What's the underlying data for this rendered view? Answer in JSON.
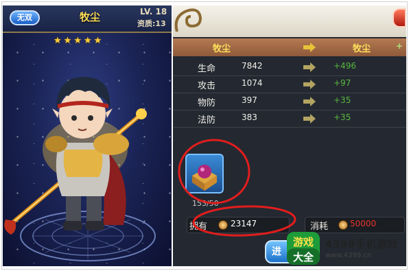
{
  "hero": {
    "mode_button": "无双",
    "name": "牧尘",
    "level": "LV. 18",
    "aptitude": "资质:13",
    "star_count": 5,
    "stars": [
      "★",
      "★",
      "★",
      "★",
      "★"
    ]
  },
  "compare": {
    "header_left": "牧尘",
    "header_right": "牧尘",
    "header_plus": "+",
    "stats": [
      {
        "label": "生命",
        "value": "7842",
        "bonus": "+496"
      },
      {
        "label": "攻击",
        "value": "1074",
        "bonus": "+97"
      },
      {
        "label": "物防",
        "value": "397",
        "bonus": "+35"
      },
      {
        "label": "法防",
        "value": "383",
        "bonus": "+35"
      }
    ]
  },
  "materials": {
    "item_count": "153/50",
    "owned_label": "拥有",
    "owned_value": "23147",
    "cost_label": "消耗",
    "cost_value": "50000",
    "confirm_label": "进"
  },
  "watermark": {
    "logo_text_top": "游戏",
    "logo_text_bottom": "大全",
    "brand": "4399手机游戏",
    "url": "www.4399.cn"
  },
  "colors": {
    "title_gold": "#ffdd55",
    "bonus_green": "#59b83e",
    "cost_red": "#e8342a",
    "annotation_red": "#e21d1d",
    "button_blue": "#1b71c8"
  }
}
